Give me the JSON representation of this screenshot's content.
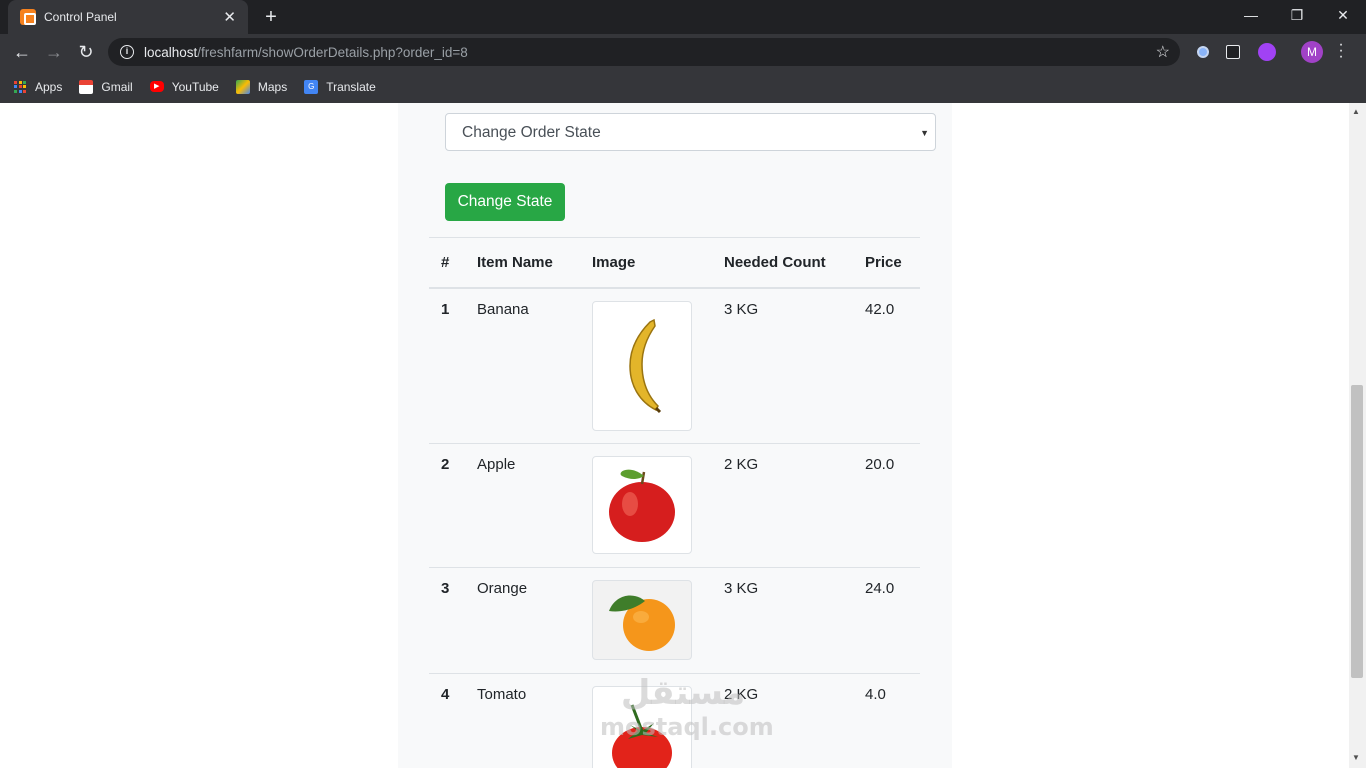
{
  "browser": {
    "tab_title": "Control Panel",
    "url_host": "localhost",
    "url_path": "/freshfarm/showOrderDetails.php?order_id=8",
    "avatar_letter": "M",
    "bookmarks": [
      {
        "label": "Apps",
        "icon": "apps-grid-icon"
      },
      {
        "label": "Gmail",
        "icon": "gmail-icon",
        "color": "#ea4335"
      },
      {
        "label": "YouTube",
        "icon": "youtube-icon",
        "color": "#ff0000"
      },
      {
        "label": "Maps",
        "icon": "maps-icon",
        "color": "#34a853"
      },
      {
        "label": "Translate",
        "icon": "translate-icon",
        "color": "#4285f4"
      }
    ]
  },
  "form": {
    "select_value": "Change Order State",
    "submit_label": "Change State",
    "submit_color": "#28a745"
  },
  "table": {
    "headers": [
      "#",
      "Item Name",
      "Image",
      "Needed Count",
      "Price"
    ],
    "rows": [
      {
        "num": "1",
        "name": "Banana",
        "image": "banana-image",
        "count": "3 KG",
        "price": "42.0"
      },
      {
        "num": "2",
        "name": "Apple",
        "image": "apple-image",
        "count": "2 KG",
        "price": "20.0"
      },
      {
        "num": "3",
        "name": "Orange",
        "image": "orange-image",
        "count": "3 KG",
        "price": "24.0"
      },
      {
        "num": "4",
        "name": "Tomato",
        "image": "tomato-image",
        "count": "2 KG",
        "price": "4.0"
      }
    ]
  },
  "watermark": {
    "arabic": "مستقل",
    "latin": "mostaql.com"
  }
}
